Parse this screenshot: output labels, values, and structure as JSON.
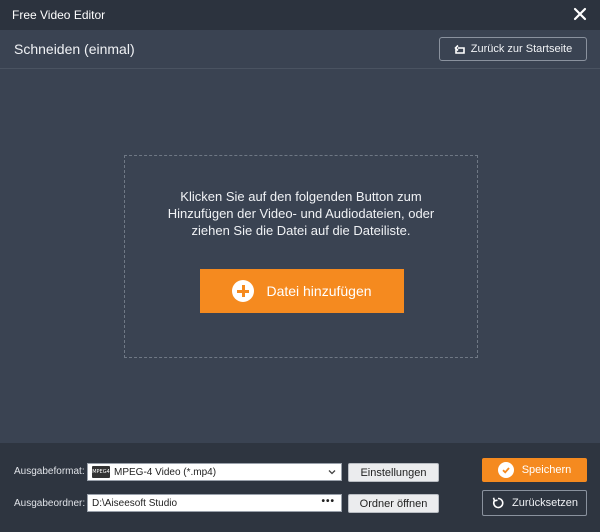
{
  "window": {
    "title": "Free Video Editor"
  },
  "header": {
    "title": "Schneiden (einmal)",
    "back_label": "Zurück zur Startseite"
  },
  "dropzone": {
    "message_line1": "Klicken Sie auf den folgenden Button zum",
    "message_line2": "Hinzufügen der Video- und Audiodateien, oder",
    "message_line3": "ziehen Sie die Datei auf die Dateiliste.",
    "add_label": "Datei hinzufügen"
  },
  "footer": {
    "format_label": "Ausgabeformat:",
    "format_value": "MPEG-4 Video (*.mp4)",
    "format_icon_text": "MPEG4",
    "settings_label": "Einstellungen",
    "folder_label": "Ausgabeordner:",
    "folder_value": "D:\\Aiseesoft Studio",
    "browse_label": "•••",
    "open_folder_label": "Ordner öffnen",
    "save_label": "Speichern",
    "reset_label": "Zurücksetzen"
  },
  "colors": {
    "accent": "#f58a1f",
    "background": "#3a4352",
    "titlebar": "#2c333e",
    "footer": "#2e3540"
  },
  "icons": [
    "close-icon",
    "back-arrow-icon",
    "plus-circle-icon",
    "format-icon",
    "chevron-down-icon",
    "check-circle-icon",
    "reset-icon"
  ]
}
